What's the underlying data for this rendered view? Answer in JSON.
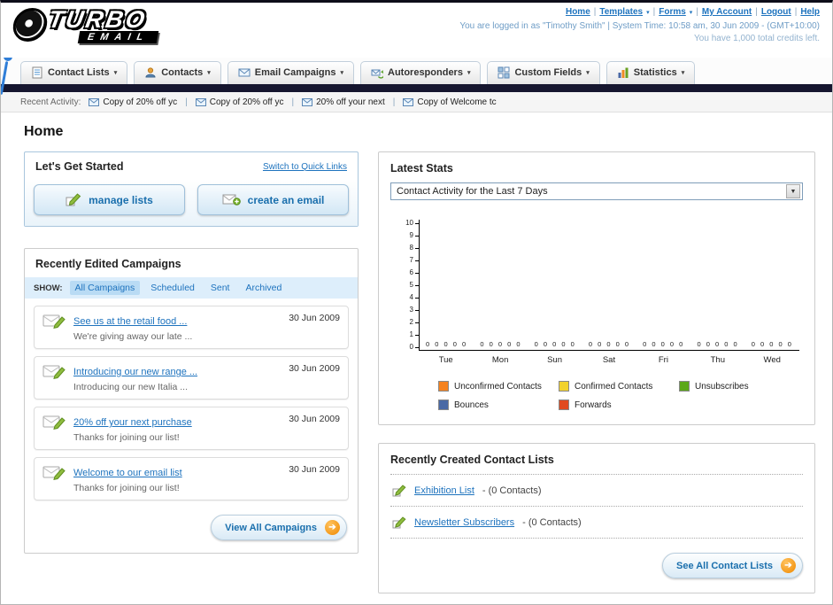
{
  "icons": {
    "caret": "▾",
    "select_caret": "▼",
    "arrow_right": "➔",
    "separator": "|"
  },
  "header": {
    "logo": {
      "title": "TURBO",
      "subtitle": "EMAIL"
    },
    "nav_links": [
      "Home",
      "Templates",
      "Forms",
      "My Account",
      "Logout",
      "Help"
    ],
    "login_info": "You are logged in as \"Timothy Smith\" | System Time: 10:58 am, 30 Jun 2009 - (GMT+10:00)",
    "credits": "You have 1,000 total credits left."
  },
  "main_nav": [
    {
      "label": "Contact Lists"
    },
    {
      "label": "Contacts"
    },
    {
      "label": "Email Campaigns"
    },
    {
      "label": "Autoresponders"
    },
    {
      "label": "Custom Fields"
    },
    {
      "label": "Statistics"
    }
  ],
  "recent_activity": {
    "label": "Recent Activity:",
    "items": [
      "Copy of 20% off yc",
      "Copy of 20% off yc",
      "20% off your next",
      "Copy of Welcome tc"
    ]
  },
  "page_title": "Home",
  "get_started": {
    "title": "Let's Get Started",
    "switch_link": "Switch to Quick Links",
    "buttons": [
      {
        "label": "manage lists"
      },
      {
        "label": "create an email"
      }
    ]
  },
  "campaigns": {
    "title": "Recently Edited Campaigns",
    "show_label": "SHOW:",
    "tabs": [
      "All Campaigns",
      "Scheduled",
      "Sent",
      "Archived"
    ],
    "active_tab": "All Campaigns",
    "items": [
      {
        "title": "See us at the retail food ...",
        "subtitle": "We're giving away our late ...",
        "date": "30 Jun 2009"
      },
      {
        "title": "Introducing our new range ...",
        "subtitle": "Introducing our new Italia ...",
        "date": "30 Jun 2009"
      },
      {
        "title": "20% off your next purchase",
        "subtitle": "Thanks for joining our list!",
        "date": "30 Jun 2009"
      },
      {
        "title": "Welcome to our email list",
        "subtitle": "Thanks for joining our list!",
        "date": "30 Jun 2009"
      }
    ],
    "view_all": "View All Campaigns"
  },
  "stats": {
    "title": "Latest Stats",
    "dropdown_value": "Contact Activity for the Last 7 Days",
    "chart_data": {
      "type": "bar",
      "categories": [
        "Tue",
        "Mon",
        "Sun",
        "Sat",
        "Fri",
        "Thu",
        "Wed"
      ],
      "series": [
        {
          "name": "Unconfirmed Contacts",
          "color": "#f5821f",
          "values": [
            0,
            0,
            0,
            0,
            0,
            0,
            0
          ]
        },
        {
          "name": "Confirmed Contacts",
          "color": "#f2d22e",
          "values": [
            0,
            0,
            0,
            0,
            0,
            0,
            0
          ]
        },
        {
          "name": "Unsubscribes",
          "color": "#5ba818",
          "values": [
            0,
            0,
            0,
            0,
            0,
            0,
            0
          ]
        },
        {
          "name": "Bounces",
          "color": "#4a69a5",
          "values": [
            0,
            0,
            0,
            0,
            0,
            0,
            0
          ]
        },
        {
          "name": "Forwards",
          "color": "#e04a1f",
          "values": [
            0,
            0,
            0,
            0,
            0,
            0,
            0
          ]
        }
      ],
      "ylim": [
        0,
        10
      ],
      "yticks": [
        0,
        1,
        2,
        3,
        4,
        5,
        6,
        7,
        8,
        9,
        10
      ],
      "legend_position": "bottom",
      "grid": false
    }
  },
  "contact_lists": {
    "title": "Recently Created Contact Lists",
    "items": [
      {
        "name": "Exhibition List",
        "detail": "- (0 Contacts)"
      },
      {
        "name": "Newsletter Subscribers",
        "detail": "- (0 Contacts)"
      }
    ],
    "see_all": "See All Contact Lists"
  }
}
